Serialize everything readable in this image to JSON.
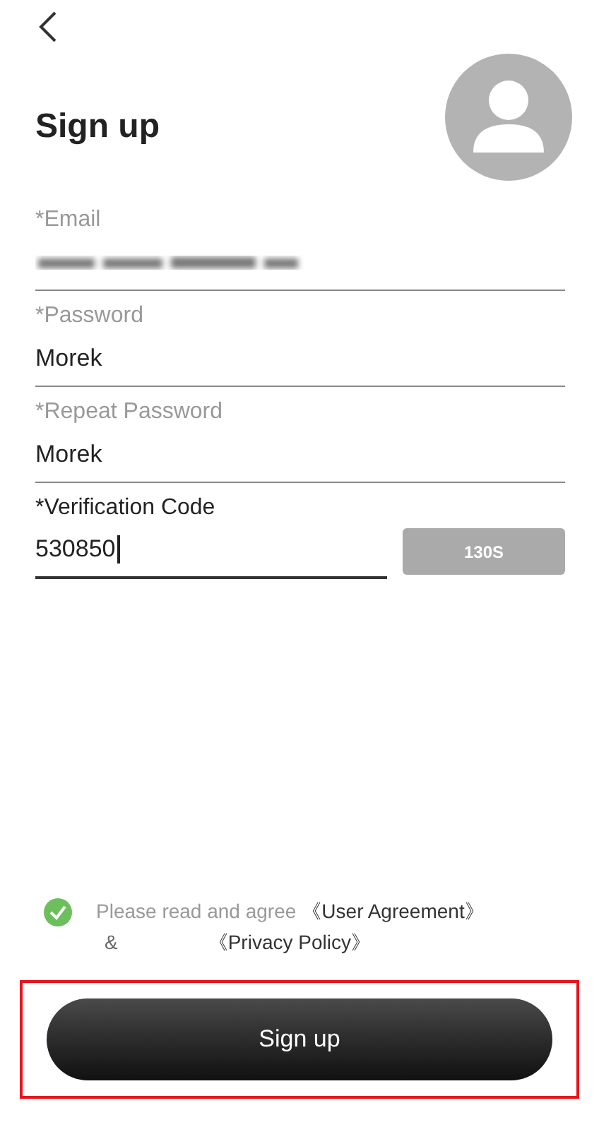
{
  "header": {
    "title": "Sign up"
  },
  "fields": [
    {
      "label": "*Email",
      "kind": "blurred",
      "focused": false
    },
    {
      "label": "*Password",
      "value": "Morek",
      "kind": "text",
      "focused": false
    },
    {
      "label": "*Repeat Password",
      "value": "Morek",
      "kind": "text",
      "focused": false
    },
    {
      "label": "*Verification Code",
      "value": "530850",
      "kind": "code",
      "focused": true,
      "button": "130S"
    }
  ],
  "agreement": {
    "checked": true,
    "text": "Please read and agree",
    "links": [
      "《User Agreement》",
      "《Privacy Policy》"
    ],
    "joiner": "&"
  },
  "submit": {
    "label": "Sign up",
    "highlighted": true
  }
}
